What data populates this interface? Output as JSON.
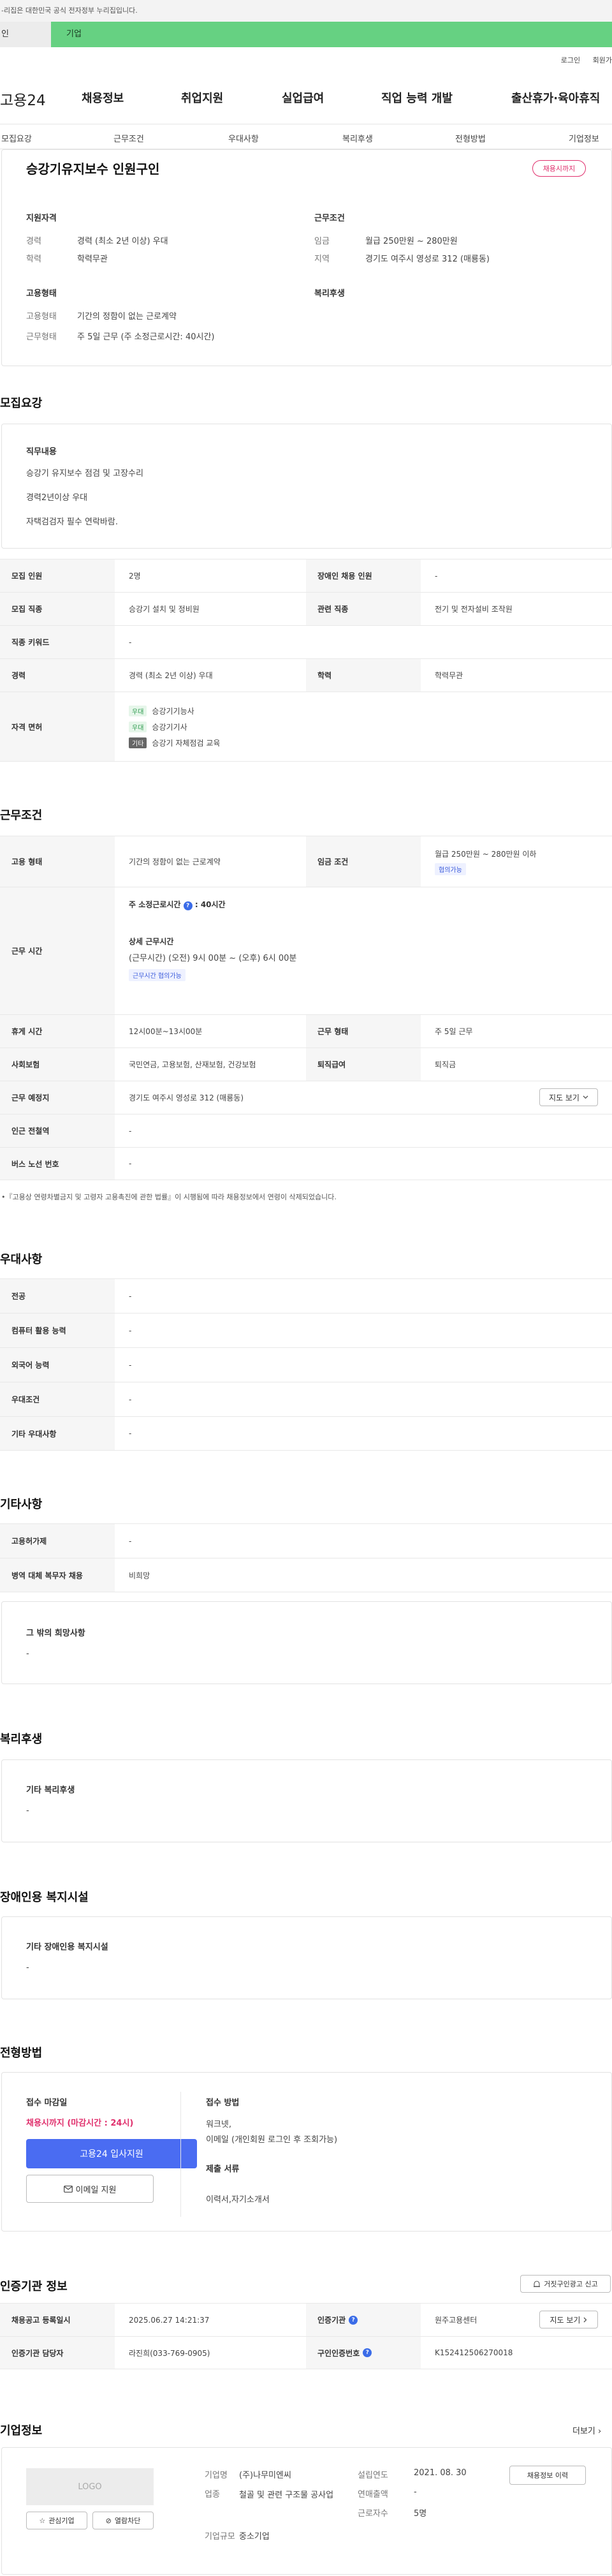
{
  "gov_banner": "-리집은 대한민국 공식 전자정부 누리집입니다.",
  "user_tabs": {
    "personal": "인",
    "business": "기업"
  },
  "top_links": {
    "login": "로그인",
    "join": "회원가"
  },
  "gnb": {
    "logo": "고용24",
    "items": [
      "채용정보",
      "취업지원",
      "실업급여",
      "직업 능력 개발",
      "출산휴가·육아휴직"
    ]
  },
  "snb": [
    "모집요강",
    "근무조건",
    "우대사항",
    "복리후생",
    "전형방법",
    "기업정보"
  ],
  "summary": {
    "title": "승강기유지보수 인원구인",
    "status_pill": "채용시까지",
    "qual_title": "지원자격",
    "career_k": "경력",
    "career_v": "경력 (최소 2년 이상) 우대",
    "edu_k": "학력",
    "edu_v": "학력무관",
    "cond_title": "근무조건",
    "wage_k": "임금",
    "wage_v": "월급 250만원 ~ 280만원",
    "area_k": "지역",
    "area_v": "경기도 여주시 영성로 312 (매룡동)",
    "emp_title": "고용형태",
    "emptype_k": "고용형태",
    "emptype_v": "기간의 정함이 없는 근로계약",
    "worktype_k": "근무형태",
    "worktype_v": "주 5일 근무 (주 소정근로시간: 40시간)",
    "welfare_title": "복리후생"
  },
  "recruit": {
    "section": "모집요강",
    "duty_title": "직무내용",
    "duty_lines": [
      "승강기 유지보수 점검 및 고장수리",
      "경력2년이상 우대",
      "자택검검자 필수 연락바람."
    ],
    "headcount_k": "모집 인원",
    "headcount_v": "2명",
    "disabled_k": "장애인 채용 인원",
    "disabled_v": "-",
    "job_k": "모집 직종",
    "job_v": "승강기 설치 및 정비원",
    "related_k": "관련 직종",
    "related_v": "전기 및 전자설비 조작원",
    "keyword_k": "직종 키워드",
    "keyword_v": "-",
    "career_k": "경력",
    "career_v": "경력 (최소 2년 이상) 우대",
    "edu_k": "학력",
    "edu_v": "학력무관",
    "license_k": "자격 면허",
    "licenses": [
      {
        "tag": "우대",
        "name": "승강기기능사"
      },
      {
        "tag": "우대",
        "name": "승강기기사"
      },
      {
        "tag": "기타",
        "name": "승강기 자체점검 교육"
      }
    ]
  },
  "work": {
    "section": "근무조건",
    "emptype_k": "고용 형태",
    "emptype_v": "기간의 정함이 없는 근로계약",
    "wage_k": "임금 조건",
    "wage_v": "월급 250만원 ~ 280만원 이하",
    "wage_tag": "협의가능",
    "hours_k": "근무 시간",
    "hours_main": "주 소정근로시간",
    "hours_main_v": ": 40시간",
    "hours_detail_t": "상세 근무시간",
    "hours_detail_v": "(근무시간) (오전) 9시 00분 ~ (오후) 6시 00분",
    "hours_tag": "근무시간 협의가능",
    "break_k": "휴게 시간",
    "break_v": "12시00분~13시00분",
    "form_k": "근무 형태",
    "form_v": "주 5일 근무",
    "insurance_k": "사회보험",
    "insurance_v": "국민연금, 고용보험, 산재보험, 건강보험",
    "severance_k": "퇴직급여",
    "severance_v": "퇴직금",
    "place_k": "근무 예정지",
    "place_v": "경기도 여주시 영성로 312 (매룡동)",
    "map_btn": "지도 보기",
    "subway_k": "인근 전철역",
    "subway_v": "-",
    "bus_k": "버스 노선 번호",
    "bus_v": "-",
    "note": "•『고용상 연령차별금지 및 고령자 고용촉진에 관한 법률』이 시행됨에 따라 채용정보에서 연령이 삭제되었습니다."
  },
  "prefer": {
    "section": "우대사항",
    "rows": [
      {
        "k": "전공",
        "v": "-"
      },
      {
        "k": "컴퓨터 활용 능력",
        "v": "-"
      },
      {
        "k": "외국어 능력",
        "v": "-"
      },
      {
        "k": "우대조건",
        "v": "-"
      },
      {
        "k": "기타 우대사항",
        "v": "-"
      }
    ]
  },
  "other": {
    "section": "기타사항",
    "rows": [
      {
        "k": "고용허가제",
        "v": "-"
      },
      {
        "k": "병역 대체 복무자 채용",
        "v": "비희망"
      }
    ],
    "wish_title": "그 밖의 희망사항",
    "wish_v": "-"
  },
  "welfare": {
    "section": "복리후생",
    "title": "기타 복리후생",
    "v": "-"
  },
  "disability": {
    "section": "장애인용 복지시설",
    "title": "기타 장애인용 복지시설",
    "v": "-"
  },
  "apply": {
    "section": "전형방법",
    "deadline_t": "접수 마감일",
    "deadline_v": "채용시까지 (마감시간 : 24시)",
    "apply_btn": "고용24 입사지원",
    "email_btn": "이메일 지원",
    "method_t": "접수 방법",
    "method_v1": "워크넷,",
    "method_v2": "이메일 (개인회원 로그인 후 조회가능)",
    "docs_t": "제출 서류",
    "docs_v": "이력서,자기소개서"
  },
  "agency": {
    "section": "인증기관 정보",
    "report_btn": "거짓구인광고 신고",
    "reg_k": "채용공고 등록일시",
    "reg_v": "2025.06.27 14:21:37",
    "org_k": "인증기관",
    "org_v": "원주고용센터",
    "map_btn": "지도 보기",
    "staff_k": "인증기관 담당자",
    "staff_v": "라진희(033-769-0905)",
    "id_k": "구인인증번호",
    "id_v": "K152412506270018"
  },
  "company": {
    "section": "기업정보",
    "more": "더보기",
    "logo": "LOGO",
    "fav_btn": "관심기업",
    "block_btn": "열람차단",
    "name_k": "기업명",
    "name_v": "(주)나무미엔씨",
    "industry_k": "업종",
    "industry_v": "철골 및 관련 구조물 공사업",
    "size_k": "기업규모",
    "size_v": "중소기업",
    "found_k": "설립연도",
    "found_v": "2021. 08. 30",
    "sales_k": "연매출액",
    "sales_v": "-",
    "emp_k": "근로자수",
    "emp_v": "5명",
    "jobs_btn": "채용정보 이력"
  }
}
